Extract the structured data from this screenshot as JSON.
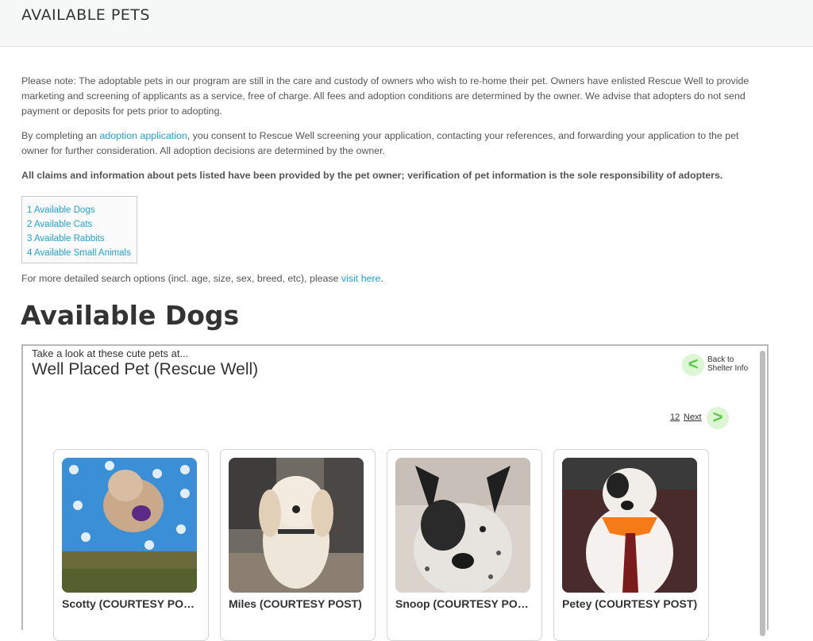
{
  "header": {
    "title": "AVAILABLE PETS"
  },
  "notice": {
    "p1": "Please note: The adoptable pets in our program are still in the care and custody of owners who wish to re-home their pet. Owners have enlisted Rescue Well to provide marketing and screening of applicants as a service, free of charge. All fees and adoption conditions are determined by the owner. We advise that adopters do not send payment or deposits for pets prior to adopting.",
    "p2_before": "By completing an ",
    "p2_link": "adoption application",
    "p2_after": ", you consent to Rescue Well screening your application, contacting your references, and forwarding your application to the pet owner for further consideration. All adoption decisions are determined by the owner.",
    "p3": "All claims and information about pets listed have been provided by the pet owner; verification of pet information is the sole responsibility of adopters."
  },
  "toc": [
    "1 Available Dogs",
    "2 Available Cats",
    "3 Available Rabbits",
    "4 Available Small Animals"
  ],
  "more": {
    "before": "For more detailed search options (incl. age, size, sex, breed, etc), please ",
    "link": "visit here",
    "after": "."
  },
  "section": {
    "title": "Available Dogs"
  },
  "widget": {
    "intro": "Take a look at these cute pets at...",
    "name": "Well Placed Pet (Rescue Well)",
    "back_line1": "Back to",
    "back_line2": "Shelter Info",
    "page_numbers": "12",
    "next_label": "Next",
    "icons": {
      "back": "chevron-left-icon",
      "next": "chevron-right-icon"
    },
    "accent_color": "#5cc94a"
  },
  "pets": [
    {
      "name": "Scotty (COURTESY POST)"
    },
    {
      "name": "Miles (COURTESY POST)"
    },
    {
      "name": "Snoop (COURTESY POST)"
    },
    {
      "name": "Petey (COURTESY POST)"
    }
  ]
}
